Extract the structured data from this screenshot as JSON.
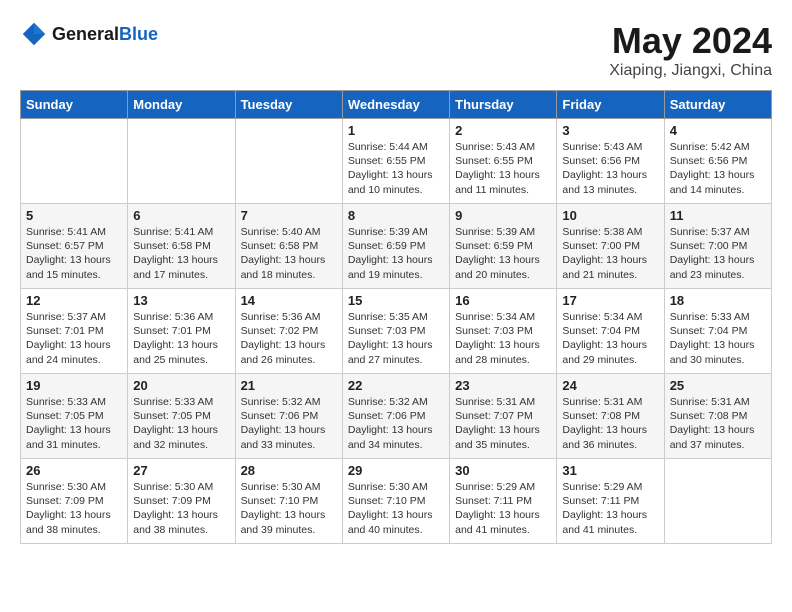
{
  "header": {
    "logo_general": "General",
    "logo_blue": "Blue",
    "month_title": "May 2024",
    "location": "Xiaping, Jiangxi, China"
  },
  "weekdays": [
    "Sunday",
    "Monday",
    "Tuesday",
    "Wednesday",
    "Thursday",
    "Friday",
    "Saturday"
  ],
  "weeks": [
    [
      {
        "day": "",
        "info": ""
      },
      {
        "day": "",
        "info": ""
      },
      {
        "day": "",
        "info": ""
      },
      {
        "day": "1",
        "info": "Sunrise: 5:44 AM\nSunset: 6:55 PM\nDaylight: 13 hours\nand 10 minutes."
      },
      {
        "day": "2",
        "info": "Sunrise: 5:43 AM\nSunset: 6:55 PM\nDaylight: 13 hours\nand 11 minutes."
      },
      {
        "day": "3",
        "info": "Sunrise: 5:43 AM\nSunset: 6:56 PM\nDaylight: 13 hours\nand 13 minutes."
      },
      {
        "day": "4",
        "info": "Sunrise: 5:42 AM\nSunset: 6:56 PM\nDaylight: 13 hours\nand 14 minutes."
      }
    ],
    [
      {
        "day": "5",
        "info": "Sunrise: 5:41 AM\nSunset: 6:57 PM\nDaylight: 13 hours\nand 15 minutes."
      },
      {
        "day": "6",
        "info": "Sunrise: 5:41 AM\nSunset: 6:58 PM\nDaylight: 13 hours\nand 17 minutes."
      },
      {
        "day": "7",
        "info": "Sunrise: 5:40 AM\nSunset: 6:58 PM\nDaylight: 13 hours\nand 18 minutes."
      },
      {
        "day": "8",
        "info": "Sunrise: 5:39 AM\nSunset: 6:59 PM\nDaylight: 13 hours\nand 19 minutes."
      },
      {
        "day": "9",
        "info": "Sunrise: 5:39 AM\nSunset: 6:59 PM\nDaylight: 13 hours\nand 20 minutes."
      },
      {
        "day": "10",
        "info": "Sunrise: 5:38 AM\nSunset: 7:00 PM\nDaylight: 13 hours\nand 21 minutes."
      },
      {
        "day": "11",
        "info": "Sunrise: 5:37 AM\nSunset: 7:00 PM\nDaylight: 13 hours\nand 23 minutes."
      }
    ],
    [
      {
        "day": "12",
        "info": "Sunrise: 5:37 AM\nSunset: 7:01 PM\nDaylight: 13 hours\nand 24 minutes."
      },
      {
        "day": "13",
        "info": "Sunrise: 5:36 AM\nSunset: 7:01 PM\nDaylight: 13 hours\nand 25 minutes."
      },
      {
        "day": "14",
        "info": "Sunrise: 5:36 AM\nSunset: 7:02 PM\nDaylight: 13 hours\nand 26 minutes."
      },
      {
        "day": "15",
        "info": "Sunrise: 5:35 AM\nSunset: 7:03 PM\nDaylight: 13 hours\nand 27 minutes."
      },
      {
        "day": "16",
        "info": "Sunrise: 5:34 AM\nSunset: 7:03 PM\nDaylight: 13 hours\nand 28 minutes."
      },
      {
        "day": "17",
        "info": "Sunrise: 5:34 AM\nSunset: 7:04 PM\nDaylight: 13 hours\nand 29 minutes."
      },
      {
        "day": "18",
        "info": "Sunrise: 5:33 AM\nSunset: 7:04 PM\nDaylight: 13 hours\nand 30 minutes."
      }
    ],
    [
      {
        "day": "19",
        "info": "Sunrise: 5:33 AM\nSunset: 7:05 PM\nDaylight: 13 hours\nand 31 minutes."
      },
      {
        "day": "20",
        "info": "Sunrise: 5:33 AM\nSunset: 7:05 PM\nDaylight: 13 hours\nand 32 minutes."
      },
      {
        "day": "21",
        "info": "Sunrise: 5:32 AM\nSunset: 7:06 PM\nDaylight: 13 hours\nand 33 minutes."
      },
      {
        "day": "22",
        "info": "Sunrise: 5:32 AM\nSunset: 7:06 PM\nDaylight: 13 hours\nand 34 minutes."
      },
      {
        "day": "23",
        "info": "Sunrise: 5:31 AM\nSunset: 7:07 PM\nDaylight: 13 hours\nand 35 minutes."
      },
      {
        "day": "24",
        "info": "Sunrise: 5:31 AM\nSunset: 7:08 PM\nDaylight: 13 hours\nand 36 minutes."
      },
      {
        "day": "25",
        "info": "Sunrise: 5:31 AM\nSunset: 7:08 PM\nDaylight: 13 hours\nand 37 minutes."
      }
    ],
    [
      {
        "day": "26",
        "info": "Sunrise: 5:30 AM\nSunset: 7:09 PM\nDaylight: 13 hours\nand 38 minutes."
      },
      {
        "day": "27",
        "info": "Sunrise: 5:30 AM\nSunset: 7:09 PM\nDaylight: 13 hours\nand 38 minutes."
      },
      {
        "day": "28",
        "info": "Sunrise: 5:30 AM\nSunset: 7:10 PM\nDaylight: 13 hours\nand 39 minutes."
      },
      {
        "day": "29",
        "info": "Sunrise: 5:30 AM\nSunset: 7:10 PM\nDaylight: 13 hours\nand 40 minutes."
      },
      {
        "day": "30",
        "info": "Sunrise: 5:29 AM\nSunset: 7:11 PM\nDaylight: 13 hours\nand 41 minutes."
      },
      {
        "day": "31",
        "info": "Sunrise: 5:29 AM\nSunset: 7:11 PM\nDaylight: 13 hours\nand 41 minutes."
      },
      {
        "day": "",
        "info": ""
      }
    ]
  ]
}
